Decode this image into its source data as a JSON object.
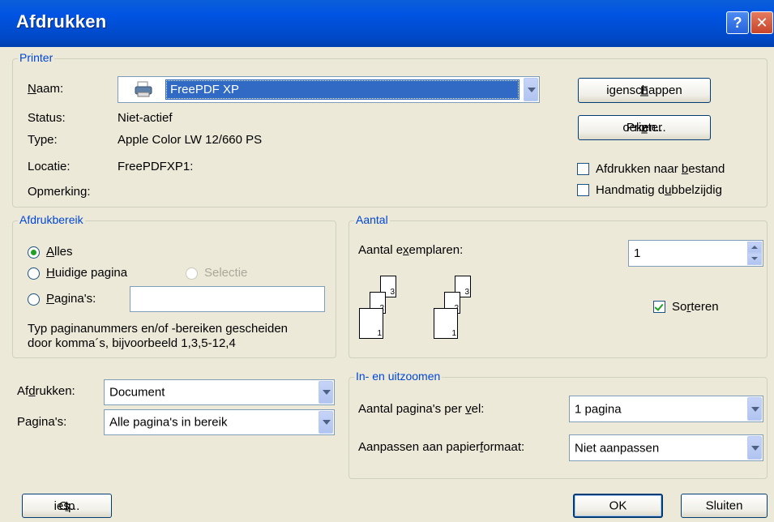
{
  "window": {
    "title": "Afdrukken",
    "help_glyph": "?",
    "close_glyph": "✕"
  },
  "printer": {
    "group_label": "Printer",
    "name_label_pre": "",
    "name_label_u": "N",
    "name_label_post": "aam:",
    "name_value": "FreePDF XP",
    "status_label": "Status:",
    "status_value": "Niet-actief",
    "type_label": "Type:",
    "type_value": "Apple Color LW 12/660 PS",
    "location_label": "Locatie:",
    "location_value": "FreePDFXP1:",
    "comment_label": "Opmerking:",
    "properties_pre": "",
    "properties_u": "E",
    "properties_post": "igenschappen",
    "find_pre": "Printer ",
    "find_u": "z",
    "find_post": "oeken...",
    "print_to_file_pre": "Afdrukken naar ",
    "print_to_file_u": "b",
    "print_to_file_post": "estand",
    "print_to_file_checked": false,
    "manual_duplex_pre": "Handmatig d",
    "manual_duplex_u": "u",
    "manual_duplex_post": "bbelzijdig",
    "manual_duplex_checked": false
  },
  "range": {
    "group_label": "Afdrukbereik",
    "all_u": "A",
    "all_post": "lles",
    "current_u": "H",
    "current_post": "uidige pagina",
    "selection": "Selectie",
    "pages_u": "P",
    "pages_post": "agina's:",
    "pages_value": "",
    "hint_line1": "Typ paginanummers en/of -bereiken gescheiden",
    "hint_line2": "door komma´s, bijvoorbeeld 1,3,5-12,4",
    "selected": "all"
  },
  "copies": {
    "group_label": "Aantal",
    "count_pre": "Aantal e",
    "count_u": "x",
    "count_post": "emplaren:",
    "count_value": "1",
    "collate_pre": "So",
    "collate_u": "r",
    "collate_post": "teren",
    "collate_checked": true,
    "page_numbers": [
      "3",
      "2",
      "1"
    ]
  },
  "print_what": {
    "what_pre": "Af",
    "what_u": "d",
    "what_post": "rukken:",
    "what_value": "Document",
    "pages_pre": "Pa",
    "pages_u": "g",
    "pages_post": "ina's:",
    "pages_value": "Alle pagina's in bereik"
  },
  "zoom": {
    "group_label": "In- en uitzoomen",
    "per_sheet_pre": "Aantal pagina's per ",
    "per_sheet_u": "v",
    "per_sheet_post": "el:",
    "per_sheet_value": "1 pagina",
    "scale_pre": "Aanpassen aan papier",
    "scale_u": "f",
    "scale_post": "ormaat:",
    "scale_value": "Niet aanpassen"
  },
  "footer": {
    "options_pre": "Op",
    "options_u": "t",
    "options_post": "ies...",
    "ok": "OK",
    "close": "Sluiten"
  }
}
